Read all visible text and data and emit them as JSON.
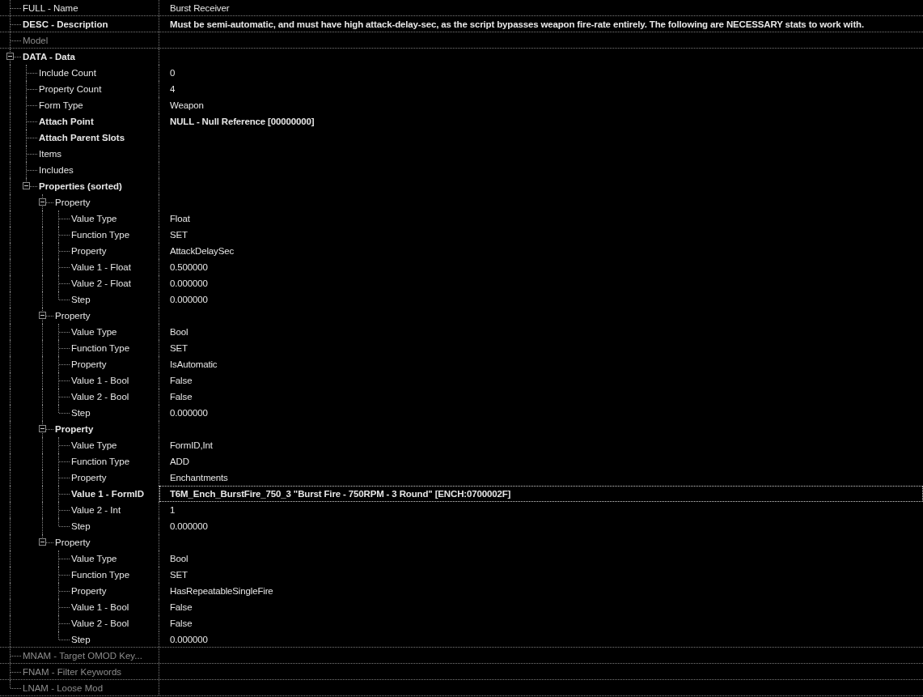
{
  "tree": [
    {
      "label": "FULL - Name",
      "value": "Burst Receiver",
      "bold": false,
      "disabled": false,
      "selected": false
    },
    {
      "label": "DESC - Description",
      "value": "Must be semi-automatic, and must have high attack-delay-sec, as the script bypasses weapon fire-rate entirely. The following are NECESSARY stats to work with.",
      "bold": true,
      "disabled": false,
      "selected": false
    },
    {
      "label": "Model",
      "bold": false,
      "disabled": true,
      "selected": false
    },
    {
      "label": "DATA - Data",
      "bold": true,
      "disabled": false,
      "selected": false,
      "expanded": true,
      "children": [
        {
          "label": "Include Count",
          "value": "0",
          "bold": false,
          "disabled": false,
          "selected": false
        },
        {
          "label": "Property Count",
          "value": "4",
          "bold": false,
          "disabled": false,
          "selected": false
        },
        {
          "label": "Form Type",
          "value": "Weapon",
          "bold": false,
          "disabled": false,
          "selected": false
        },
        {
          "label": "Attach Point",
          "value": "NULL - Null Reference [00000000]",
          "bold": true,
          "disabled": false,
          "selected": false
        },
        {
          "label": "Attach Parent Slots",
          "bold": true,
          "disabled": false,
          "selected": false
        },
        {
          "label": "Items",
          "bold": false,
          "disabled": false,
          "selected": false
        },
        {
          "label": "Includes",
          "bold": false,
          "disabled": false,
          "selected": false
        },
        {
          "label": "Properties (sorted)",
          "bold": true,
          "disabled": false,
          "selected": false,
          "expanded": true,
          "children": [
            {
              "label": "Property",
              "bold": false,
              "disabled": false,
              "selected": false,
              "expanded": true,
              "children": [
                {
                  "label": "Value Type",
                  "value": "Float",
                  "bold": false,
                  "disabled": false,
                  "selected": false
                },
                {
                  "label": "Function Type",
                  "value": "SET",
                  "bold": false,
                  "disabled": false,
                  "selected": false
                },
                {
                  "label": "Property",
                  "value": "AttackDelaySec",
                  "bold": false,
                  "disabled": false,
                  "selected": false
                },
                {
                  "label": "Value 1 - Float",
                  "value": "0.500000",
                  "bold": false,
                  "disabled": false,
                  "selected": false
                },
                {
                  "label": "Value 2 - Float",
                  "value": "0.000000",
                  "bold": false,
                  "disabled": false,
                  "selected": false
                },
                {
                  "label": "Step",
                  "value": "0.000000",
                  "bold": false,
                  "disabled": false,
                  "selected": false
                }
              ]
            },
            {
              "label": "Property",
              "bold": false,
              "disabled": false,
              "selected": false,
              "expanded": true,
              "children": [
                {
                  "label": "Value Type",
                  "value": "Bool",
                  "bold": false,
                  "disabled": false,
                  "selected": false
                },
                {
                  "label": "Function Type",
                  "value": "SET",
                  "bold": false,
                  "disabled": false,
                  "selected": false
                },
                {
                  "label": "Property",
                  "value": "IsAutomatic",
                  "bold": false,
                  "disabled": false,
                  "selected": false
                },
                {
                  "label": "Value 1 - Bool",
                  "value": "False",
                  "bold": false,
                  "disabled": false,
                  "selected": false
                },
                {
                  "label": "Value 2 - Bool",
                  "value": "False",
                  "bold": false,
                  "disabled": false,
                  "selected": false
                },
                {
                  "label": "Step",
                  "value": "0.000000",
                  "bold": false,
                  "disabled": false,
                  "selected": false
                }
              ]
            },
            {
              "label": "Property",
              "bold": true,
              "disabled": false,
              "selected": false,
              "expanded": true,
              "children": [
                {
                  "label": "Value Type",
                  "value": "FormID,Int",
                  "bold": false,
                  "disabled": false,
                  "selected": false
                },
                {
                  "label": "Function Type",
                  "value": "ADD",
                  "bold": false,
                  "disabled": false,
                  "selected": false
                },
                {
                  "label": "Property",
                  "value": "Enchantments",
                  "bold": false,
                  "disabled": false,
                  "selected": false
                },
                {
                  "label": "Value 1 - FormID",
                  "value": "T6M_Ench_BurstFire_750_3 \"Burst Fire - 750RPM - 3 Round\" [ENCH:0700002F]",
                  "bold": true,
                  "disabled": false,
                  "selected": true
                },
                {
                  "label": "Value 2 - Int",
                  "value": "1",
                  "bold": false,
                  "disabled": false,
                  "selected": false
                },
                {
                  "label": "Step",
                  "value": "0.000000",
                  "bold": false,
                  "disabled": false,
                  "selected": false
                }
              ]
            },
            {
              "label": "Property",
              "bold": false,
              "disabled": false,
              "selected": false,
              "expanded": true,
              "children": [
                {
                  "label": "Value Type",
                  "value": "Bool",
                  "bold": false,
                  "disabled": false,
                  "selected": false
                },
                {
                  "label": "Function Type",
                  "value": "SET",
                  "bold": false,
                  "disabled": false,
                  "selected": false
                },
                {
                  "label": "Property",
                  "value": "HasRepeatableSingleFire",
                  "bold": false,
                  "disabled": false,
                  "selected": false
                },
                {
                  "label": "Value 1 - Bool",
                  "value": "False",
                  "bold": false,
                  "disabled": false,
                  "selected": false
                },
                {
                  "label": "Value 2 - Bool",
                  "value": "False",
                  "bold": false,
                  "disabled": false,
                  "selected": false
                },
                {
                  "label": "Step",
                  "value": "0.000000",
                  "bold": false,
                  "disabled": false,
                  "selected": false
                }
              ]
            }
          ]
        }
      ]
    },
    {
      "label": "MNAM - Target OMOD Key...",
      "bold": false,
      "disabled": true,
      "selected": false
    },
    {
      "label": "FNAM - Filter Keywords",
      "bold": false,
      "disabled": true,
      "selected": false
    },
    {
      "label": "LNAM - Loose Mod",
      "bold": false,
      "disabled": true,
      "selected": false
    }
  ]
}
